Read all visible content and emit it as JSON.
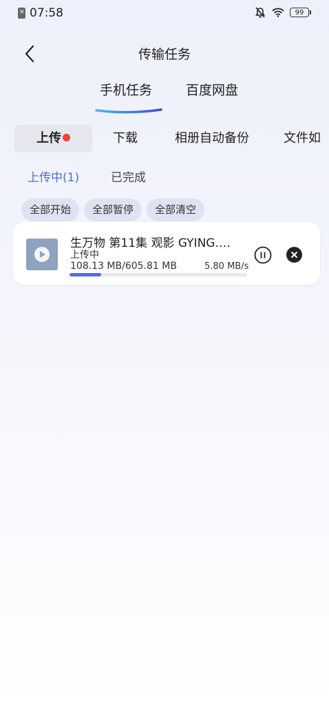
{
  "status_bar": {
    "time": "07:58",
    "battery": "99"
  },
  "header": {
    "title": "传输任务"
  },
  "top_tabs": [
    {
      "label": "手机任务",
      "active": true
    },
    {
      "label": "百度网盘",
      "active": false
    }
  ],
  "categories": [
    {
      "label": "上传",
      "active": true,
      "has_dot": true
    },
    {
      "label": "下载",
      "active": false
    },
    {
      "label": "相册自动备份",
      "active": false
    },
    {
      "label": "文件如",
      "active": false
    }
  ],
  "sub_tabs": [
    {
      "label": "上传中(1)",
      "active": true
    },
    {
      "label": "已完成",
      "active": false
    }
  ],
  "actions": {
    "start_all": "全部开始",
    "pause_all": "全部暂停",
    "clear_all": "全部清空"
  },
  "task": {
    "name": "生万物 第11集  观影 GYING.…",
    "status": "上传中",
    "size": "108.13 MB/605.81 MB",
    "speed": "5.80 MB/s",
    "progress": 0.1785,
    "progress_color": "#4f6de8"
  },
  "colors": {
    "accent": "#4a6fd6",
    "dot": "#ef4135"
  }
}
